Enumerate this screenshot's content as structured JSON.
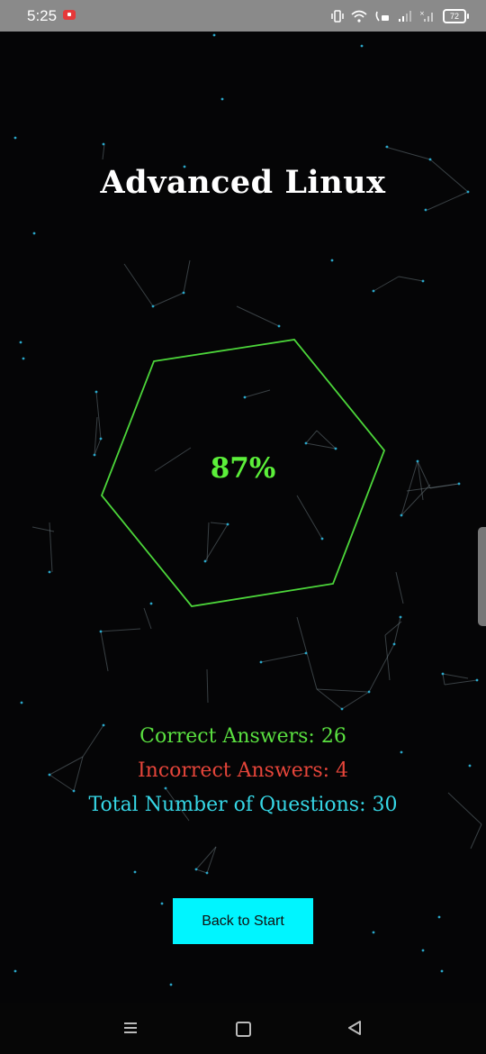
{
  "status_bar": {
    "time": "5:25",
    "battery": "72",
    "icons": [
      "screen-record-icon",
      "vibrate-icon",
      "wifi-icon",
      "volte-icon",
      "signal-icon",
      "signal-icon",
      "battery-icon"
    ]
  },
  "quiz_result": {
    "title": "Advanced Linux",
    "score": "87%",
    "correct": "Correct Answers: 26",
    "incorrect": "Incorrect Answers: 4",
    "total": "Total Number of Questions: 30",
    "back_button": "Back to Start"
  },
  "colors": {
    "background": "#050506",
    "hexagon": "#4cd63a",
    "correct": "#5ae040",
    "incorrect": "#e6453a",
    "total": "#36d7e6",
    "button": "#00f5ff",
    "particles": "#2aa7c9"
  },
  "nav_bar": {
    "icons": [
      "menu-icon",
      "home-icon",
      "back-icon"
    ]
  }
}
